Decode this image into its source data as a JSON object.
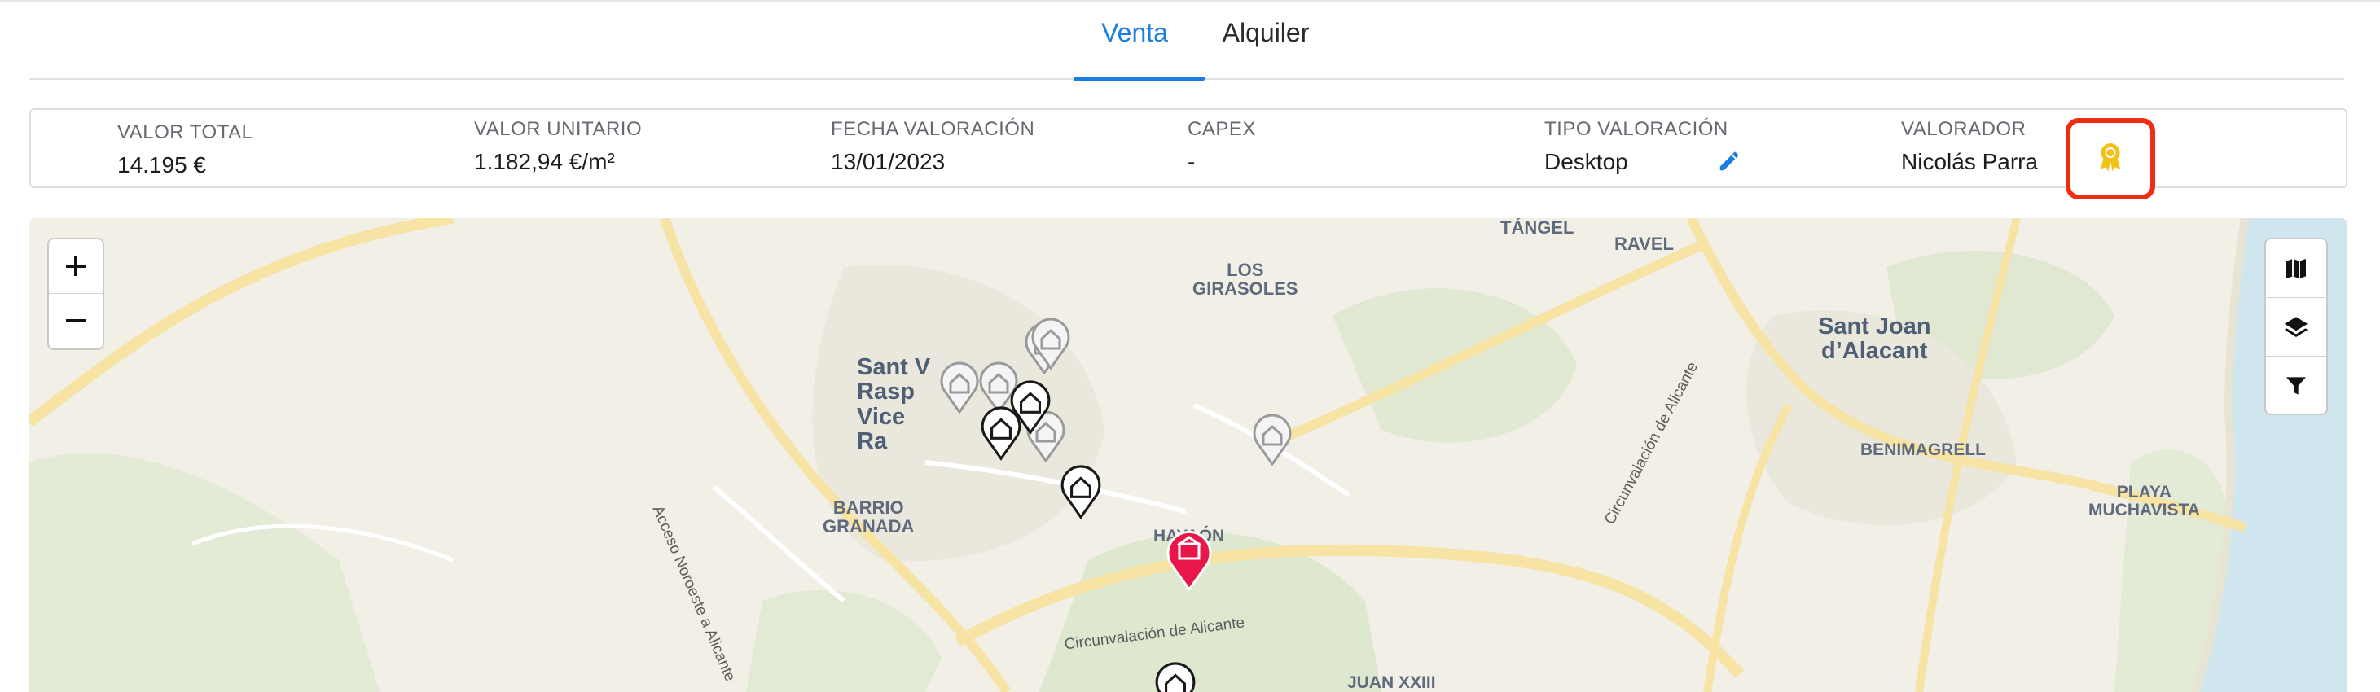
{
  "tabs": [
    {
      "label": "Venta",
      "active": true
    },
    {
      "label": "Alquiler",
      "active": false
    }
  ],
  "summary": {
    "valor_total": {
      "label": "VALOR TOTAL",
      "value": "14.195 €"
    },
    "valor_unitario": {
      "label": "VALOR UNITARIO",
      "value": "1.182,94 €/m²"
    },
    "fecha_valoracion": {
      "label": "FECHA VALORACIÓN",
      "value": "13/01/2023"
    },
    "capex": {
      "label": "CAPEX",
      "value": "-"
    },
    "tipo_valoracion": {
      "label": "TIPO VALORACIÓN",
      "value": "Desktop"
    },
    "valorador": {
      "label": "VALORADOR",
      "value": "Nicolás Parra"
    }
  },
  "icons": {
    "edit": "pencil-icon",
    "award": "award-ribbon-icon",
    "map_type": "map-icon",
    "layers": "layers-icon",
    "filter": "filter-icon"
  },
  "map": {
    "zoom_in": "+",
    "zoom_out": "−",
    "places": {
      "tangel": "TÁNGEL",
      "ravel": "RAVEL",
      "los_girasoles": "LOS\nGIRASOLES",
      "sant_joan": "Sant Joan\nd’Alacant",
      "benimagrell": "BENIMAGRELL",
      "playa_muchavista": "PLAYA\nMUCHAVISTA",
      "sant_vicent": "Sant V\nRasp\nVice\nRa",
      "barrio_granada": "BARRIO\nGRANADA",
      "hayaon": "HAYAÓN",
      "juan_xxiii": "JUAN XXIII"
    },
    "roads": {
      "acceso_noroeste": "Acceso Noroeste a Alicante",
      "circunvalacion_1": "Circunvalación de Alicante",
      "circunvalacion_2": "Circunvalación de Alicante"
    }
  },
  "colors": {
    "accent": "#1a7fe0",
    "highlight_border": "#ee2d12",
    "award": "#f2c21b",
    "subject_marker": "#e8174a"
  }
}
